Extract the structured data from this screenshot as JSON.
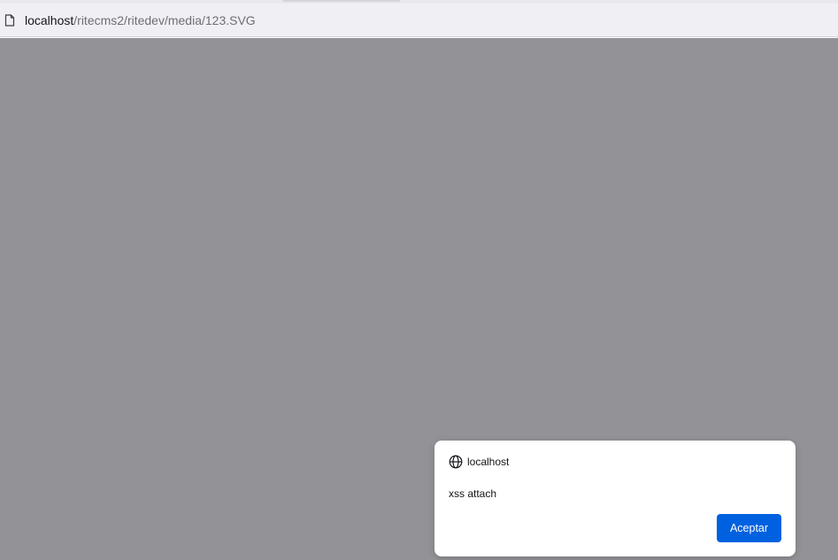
{
  "browser": {
    "url_host": "localhost",
    "url_path": "/ritecms2/ritedev/media/123.SVG",
    "page_icon": "document-icon"
  },
  "dialog": {
    "site_icon": "globe-icon",
    "title": "localhost",
    "message": "xss attach",
    "accept_label": "Aceptar"
  },
  "colors": {
    "overlay": "#939297",
    "accent": "#0061e0",
    "toolbar": "#f0f0f4"
  }
}
